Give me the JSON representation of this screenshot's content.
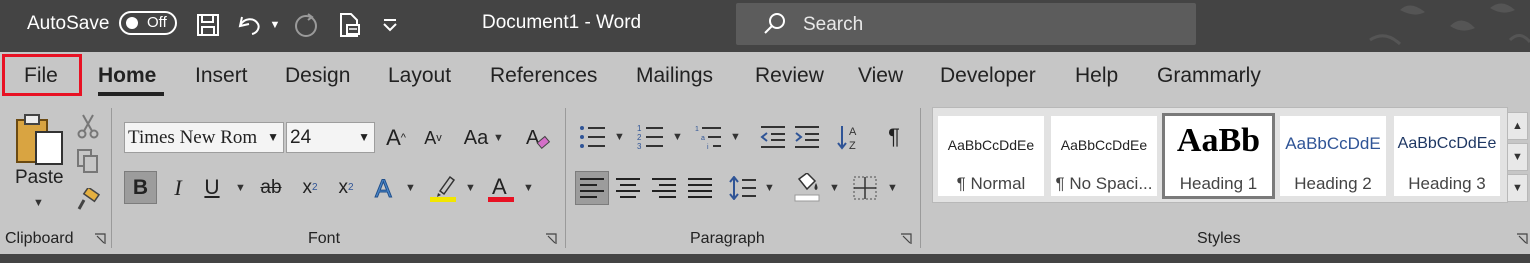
{
  "titlebar": {
    "autosave_label": "AutoSave",
    "autosave_state": "Off",
    "document_title": "Document1  -  Word",
    "search_placeholder": "Search"
  },
  "tabs": [
    "File",
    "Home",
    "Insert",
    "Design",
    "Layout",
    "References",
    "Mailings",
    "Review",
    "View",
    "Developer",
    "Help",
    "Grammarly"
  ],
  "active_tab": "Home",
  "clipboard": {
    "paste_label": "Paste",
    "group_label": "Clipboard"
  },
  "font": {
    "font_name": "Times New Rom",
    "font_size": "24",
    "case_label": "Aa",
    "group_label": "Font",
    "highlight_color": "#f2e600",
    "font_color": "#e81123"
  },
  "paragraph": {
    "group_label": "Paragraph"
  },
  "styles": {
    "group_label": "Styles",
    "items": [
      {
        "preview": "AaBbCcDdEe",
        "name": "¶ Normal"
      },
      {
        "preview": "AaBbCcDdEe",
        "name": "¶ No Spaci..."
      },
      {
        "preview": "AaBb",
        "name": "Heading 1"
      },
      {
        "preview": "AaBbCcDdE",
        "name": "Heading 2"
      },
      {
        "preview": "AaBbCcDdEe",
        "name": "Heading 3"
      }
    ]
  },
  "colors": {
    "title_bar": "#444444",
    "ribbon": "#c6c6c6",
    "file_highlight": "#e81123",
    "heading_blue": "#2f5496"
  }
}
